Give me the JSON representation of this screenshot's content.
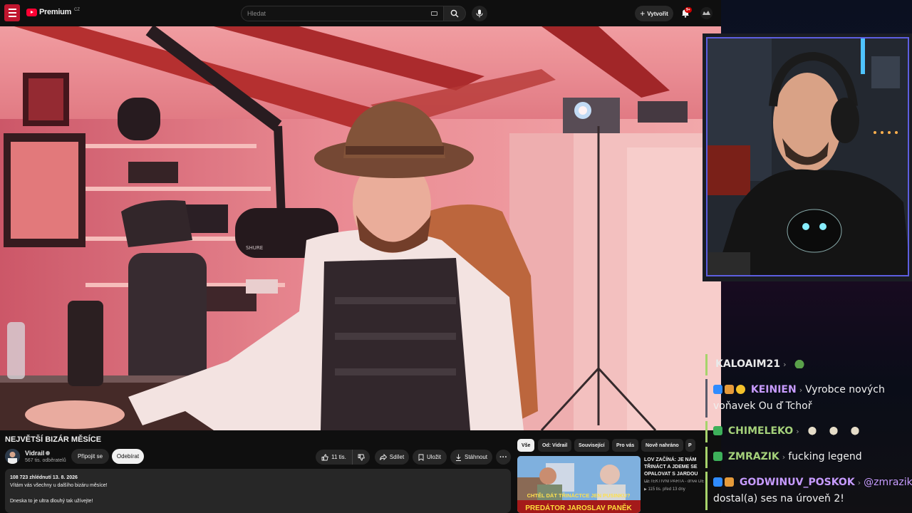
{
  "youtube": {
    "logo_text": "Premium",
    "logo_region": "CZ",
    "search_placeholder": "Hledat",
    "create_label": "Vytvořit",
    "notif_count": "9+",
    "video_title": "NEJVĚTŠÍ BIZÁR MĚSÍCE",
    "channel_name": "Vidrail",
    "channel_subs": "567 tis. odběratelů",
    "join_label": "Připojit se",
    "subscribe_label": "Odebírat",
    "like_count": "11 tis.",
    "share_label": "Sdílet",
    "save_label": "Uložit",
    "download_label": "Stáhnout",
    "desc_meta": "108 723 zhlédnutí  13. 8. 2026",
    "desc_line1": "Vítám vás všechny u dalšího bizáru měsíce!",
    "desc_line2": "Dneska to je ultra dlouhý tak užívejte!",
    "chips": [
      "Vše",
      "Od: Vidrail",
      "Související",
      "Pro vás",
      "Nově nahráno",
      "P"
    ],
    "rec_title": "LOV ZAČÍNÁ: JE NÁM TŘINÁCT A JDEME SE OPALOVAT S JARDOU ...",
    "rec_channel": "DETEKTIVNÍ PARTA - dříve DETE",
    "rec_stats": "115 tis.  před 13 dny",
    "rec_thumb_text1": "CHTĚL DÁT TŘINÁCTCE JEN PUSINKU?",
    "rec_thumb_text2": "PREDÁTOR JAROSLAV PANĚK",
    "mic_brand": "SHURE"
  },
  "chat": {
    "messages": [
      {
        "user": "KALOAIM21",
        "text": ""
      },
      {
        "user": "KEINIEN",
        "text": "Vyrobce nových",
        "text2": "voňavek Ou ď Tchoř"
      },
      {
        "user": "CHIMELEKO",
        "text": ""
      },
      {
        "user": "ZMRAZIK",
        "text": "fucking legend"
      },
      {
        "user": "GODWINUV_POSKOK",
        "text": "@zmrazik",
        "text2": "dostal(a) ses na úroveň 2!"
      }
    ]
  },
  "colors": {
    "accent": "#ff0033",
    "cam_border": "#5d5ee0",
    "chat_bar": "#a6d36b",
    "name_purple": "#c79bff",
    "name_green": "#a4d07a"
  },
  "icons": [
    "menu-icon",
    "youtube-logo-icon",
    "keyboard-icon",
    "search-icon",
    "mic-icon",
    "plus-icon",
    "bell-icon",
    "like-icon",
    "dislike-icon",
    "share-icon",
    "save-icon",
    "download-icon",
    "more-icon",
    "verified-icon"
  ]
}
